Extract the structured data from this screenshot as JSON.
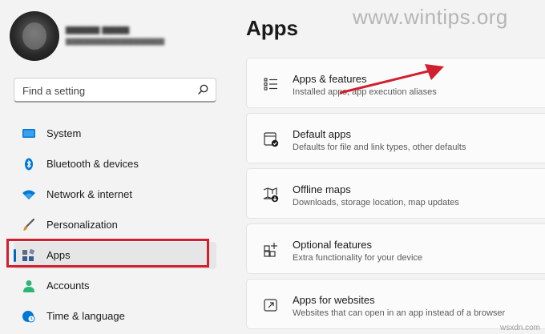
{
  "watermark": "www.wintips.org",
  "credit": "wsxdn.com",
  "search": {
    "placeholder": "Find a setting"
  },
  "nav": [
    {
      "label": "System",
      "icon": "monitor-icon",
      "color": "#0078d4"
    },
    {
      "label": "Bluetooth & devices",
      "icon": "bluetooth-icon",
      "color": "#0078d4"
    },
    {
      "label": "Network & internet",
      "icon": "wifi-icon",
      "color": "#0078d4"
    },
    {
      "label": "Personalization",
      "icon": "brush-icon",
      "color": "#e08a2d"
    },
    {
      "label": "Apps",
      "icon": "apps-icon",
      "color": "#3a5b8c",
      "selected": true
    },
    {
      "label": "Accounts",
      "icon": "person-icon",
      "color": "#2bb673"
    },
    {
      "label": "Time & language",
      "icon": "globe-clock-icon",
      "color": "#0078d4"
    }
  ],
  "main": {
    "title": "Apps",
    "cards": [
      {
        "title": "Apps & features",
        "subtitle": "Installed apps, app execution aliases",
        "icon": "list-icon"
      },
      {
        "title": "Default apps",
        "subtitle": "Defaults for file and link types, other defaults",
        "icon": "default-apps-icon"
      },
      {
        "title": "Offline maps",
        "subtitle": "Downloads, storage location, map updates",
        "icon": "map-icon"
      },
      {
        "title": "Optional features",
        "subtitle": "Extra functionality for your device",
        "icon": "grid-plus-icon"
      },
      {
        "title": "Apps for websites",
        "subtitle": "Websites that can open in an app instead of a browser",
        "icon": "open-link-icon"
      }
    ]
  },
  "colors": {
    "accent": "#0067c0",
    "annotation_red": "#d01f2f"
  }
}
